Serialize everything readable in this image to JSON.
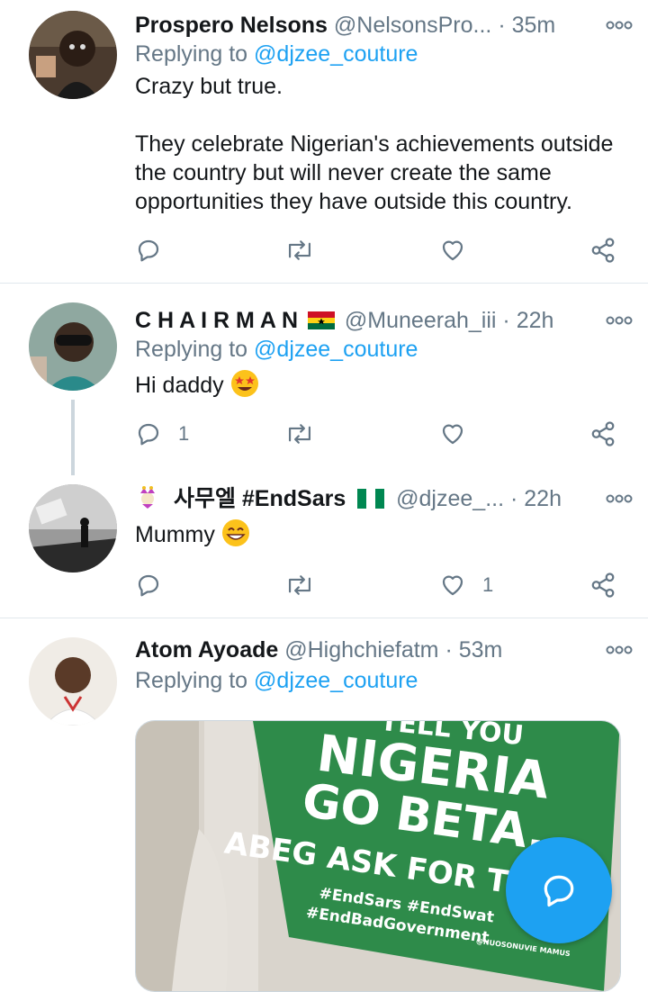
{
  "tweets": [
    {
      "name": "Prospero Nelsons",
      "handle": "@NelsonsPro...",
      "time": "35m",
      "reply_prefix": "Replying to",
      "reply_to": "@djzee_couture",
      "text_1": "Crazy but true.",
      "text_2": "They celebrate Nigerian's achievements outside the country but will never create the same opportunities they have outside this country."
    },
    {
      "name": "C H A I R M A N",
      "handle": "@Muneerah_iii",
      "time": "22h",
      "reply_prefix": "Replying to",
      "reply_to": "@djzee_couture",
      "text": "Hi daddy",
      "reply_count": "1"
    },
    {
      "name": "사무엘 #EndSars",
      "handle": "@djzee_...",
      "time": "22h",
      "text": "Mummy",
      "like_count": "1"
    },
    {
      "name": "Atom Ayoade",
      "handle": "@Highchiefatm",
      "time": "53m",
      "reply_prefix": "Replying to",
      "reply_to": "@djzee_couture"
    }
  ],
  "media_sign": {
    "line1": "TELL YOU",
    "line2": "NIGERIA",
    "line3": "GO BETA,",
    "line4": "ABEG ASK FOR THE",
    "hashtags1": "#EndSars #EndSwat",
    "hashtags2": "#EndBadGovernment",
    "credit": "@NUOSONUVIE MAMUS"
  },
  "icons": {
    "reply": "reply-icon",
    "retweet": "retweet-icon",
    "like": "like-icon",
    "share": "share-icon",
    "more": "more-icon",
    "compose": "compose-reply-icon"
  },
  "colors": {
    "accent": "#1da1f2",
    "muted": "#657786",
    "divider": "#e1e8ed",
    "sign_green": "#2e8b4a"
  }
}
